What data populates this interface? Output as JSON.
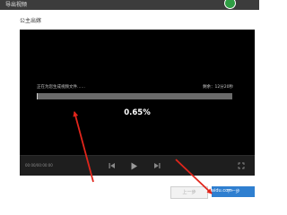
{
  "window": {
    "title": "导出视频"
  },
  "section": {
    "label": "公主出嫁"
  },
  "export": {
    "status_text": "正在为您生成视频文件……",
    "remaining": "剩余：12分20秒",
    "percent_label": "0.65%",
    "progress_fraction": 0.0065
  },
  "player": {
    "time": "00:00/00:00:00"
  },
  "footer": {
    "prev_label": "上一步",
    "next_label": "下一步"
  },
  "watermark": "n.baidu.com",
  "colors": {
    "titlebar": "#3c3c3c",
    "preview": "#000000",
    "next_button": "#2f7fd0",
    "annotation_arrow": "#e1251b"
  },
  "icons": {
    "prev": "skip-back-icon",
    "play": "play-icon",
    "next": "skip-forward-icon",
    "fullscreen": "fullscreen-icon"
  }
}
